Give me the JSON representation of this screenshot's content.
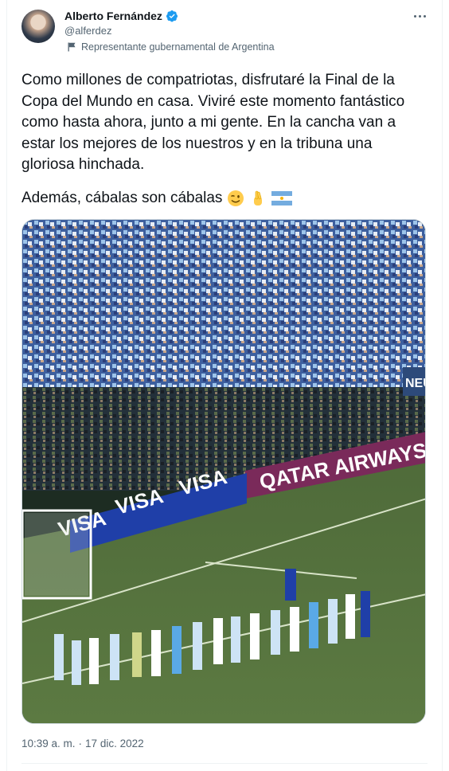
{
  "author": {
    "name": "Alberto Fernández",
    "handle": "@alferdez",
    "label": "Representante gubernamental de Argentina"
  },
  "tweet": {
    "text": "Como millones de compatriotas, disfrutaré la Final de la Copa del Mundo en casa. Viviré este momento fantástico como hasta ahora, junto a mi gente. En la cancha van a estar los mejores de los nuestros y en la tribuna una gloriosa hinchada.",
    "second_line": "Además, cábalas son cábalas",
    "emojis": [
      "winking-face",
      "crossed-fingers",
      "argentina-flag"
    ]
  },
  "media": {
    "banner_1": "QATAR AIRWAYS",
    "banner_2": "VISA",
    "banner_3": "VISA",
    "banner_4": "VISA",
    "banner_5": "NEU"
  },
  "meta": {
    "time": "10:39 a. m.",
    "separator": "·",
    "date": "17 dic. 2022"
  },
  "colors": {
    "verified": "#1d9bf0",
    "secondary_text": "#536471"
  }
}
